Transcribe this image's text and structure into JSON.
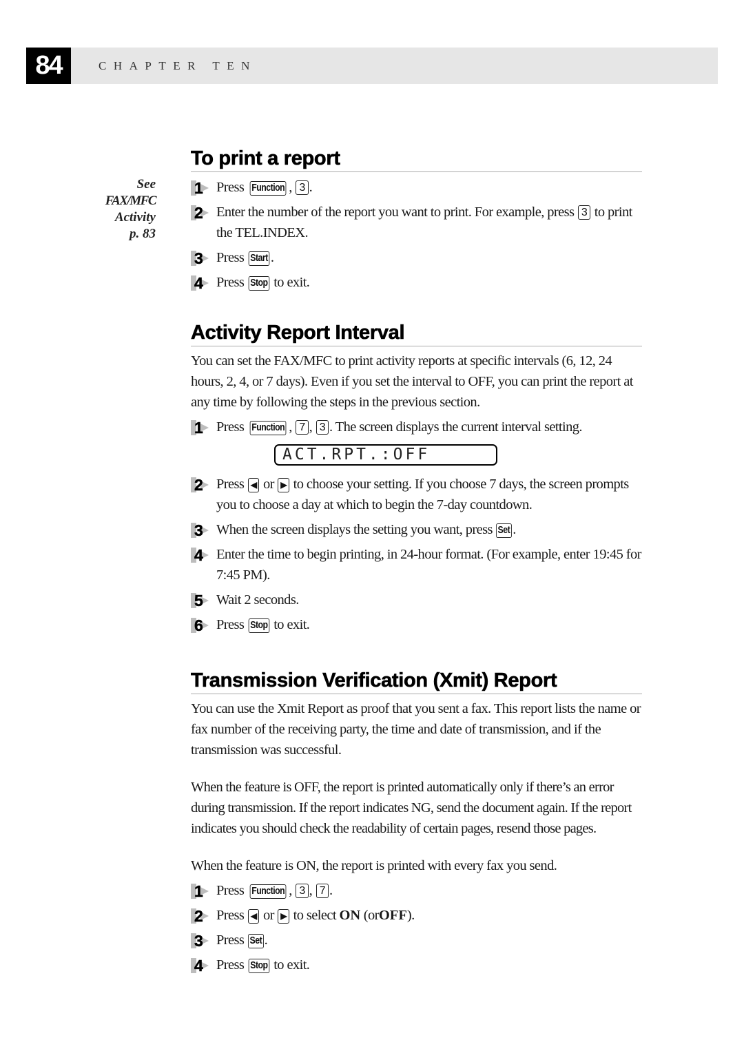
{
  "header": {
    "page_number": "84",
    "chapter_title": "CHAPTER TEN"
  },
  "sidenote": {
    "line1": "See",
    "line2": "FAX/MFC",
    "line3": "Activity",
    "line4": "p. 83"
  },
  "sections": [
    {
      "title": "To print a report",
      "steps": [
        {
          "number": "1",
          "text_before": "Press",
          "keys": [
            "Function",
            "3"
          ],
          "text_after": "."
        },
        {
          "number": "2",
          "text_before": "Enter the number of the report you want to print.  For example, press",
          "keys": [
            "3"
          ],
          "text_after": "to print the TEL.INDEX."
        },
        {
          "number": "3",
          "text_before": "Press",
          "keys": [
            "Start"
          ],
          "text_after": "."
        },
        {
          "number": "4",
          "text_before": "Press",
          "keys": [
            "Stop"
          ],
          "text_after": "to exit."
        }
      ]
    },
    {
      "title": "Activity Report Interval",
      "intro": "You can set the FAX/MFC to print activity reports at specific intervals (6, 12, 24 hours, 2, 4, or 7 days).  Even if you set the interval to OFF, you can print the report at any time by following the steps in the previous section.",
      "lcd_display": "ACT.RPT.:OFF",
      "steps": [
        {
          "number": "1",
          "text_before": "Press",
          "keys": [
            "Function",
            "7",
            "3"
          ],
          "text_after": ".  The screen displays the current interval setting."
        },
        {
          "number": "2",
          "text_before": "Press",
          "keys": [
            "◀",
            "▶"
          ],
          "joiner": "or",
          "text_after": "to choose your setting.  If you choose 7 days, the screen prompts you to choose a day at which to begin the 7-day countdown."
        },
        {
          "number": "3",
          "text_before": "When the screen displays the setting you want, press",
          "keys": [
            "Set"
          ],
          "text_after": "."
        },
        {
          "number": "4",
          "text_before": "Enter the time to begin printing, in 24-hour format.  (For example, enter 19:45 for 7:45 PM).",
          "keys": [],
          "text_after": ""
        },
        {
          "number": "5",
          "text_before": "Wait 2 seconds.",
          "keys": [],
          "text_after": ""
        },
        {
          "number": "6",
          "text_before": "Press",
          "keys": [
            "Stop"
          ],
          "text_after": "to exit."
        }
      ]
    },
    {
      "title": "Transmission Verification (Xmit) Report",
      "paragraphs": [
        "You can use the Xmit Report as proof that you sent a fax.  This report lists the name or fax number of the receiving party, the time and date of transmission, and if the transmission was successful.",
        "When the feature is OFF, the report is printed automatically only if there’s an error during transmission.  If the report indicates NG, send the document again.  If the report indicates you should check the readability of certain pages, resend those pages.",
        "When the feature is ON, the report is printed with every fax you send."
      ],
      "steps": [
        {
          "number": "1",
          "text_before": "Press",
          "keys": [
            "Function",
            "3",
            "7"
          ],
          "text_after": "."
        },
        {
          "number": "2",
          "text_before": "Press",
          "keys": [
            "◀",
            "▶"
          ],
          "joiner": "or",
          "text_mid": "to select",
          "bold1": "ON",
          "text_mid2": "(or",
          "bold2": "OFF",
          "text_after": ")."
        },
        {
          "number": "3",
          "text_before": "Press",
          "keys": [
            "Set"
          ],
          "text_after": "."
        },
        {
          "number": "4",
          "text_before": "Press",
          "keys": [
            "Stop"
          ],
          "text_after": "to exit."
        }
      ]
    }
  ]
}
